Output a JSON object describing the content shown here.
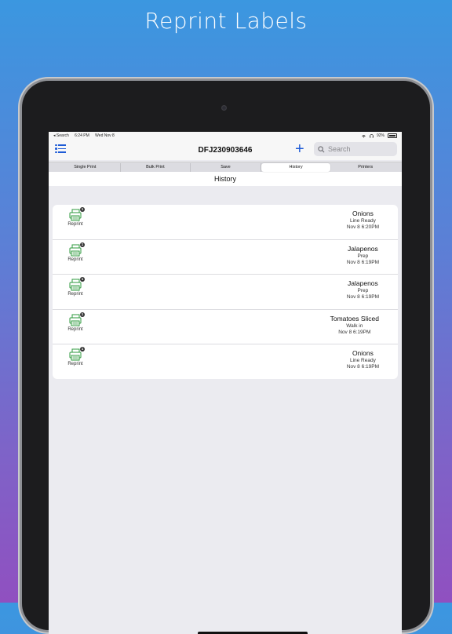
{
  "headline": "Reprint Labels",
  "status_bar": {
    "back_app": "◂ Search",
    "time": "6:24 PM",
    "date": "Wed Nov 8",
    "battery": "92%"
  },
  "nav": {
    "title": "DFJ230903646",
    "plus": "+",
    "search_placeholder": "Search"
  },
  "segments": [
    {
      "label": "Single Print"
    },
    {
      "label": "Bulk Print"
    },
    {
      "label": "Save"
    },
    {
      "label": "History"
    },
    {
      "label": "Printers"
    }
  ],
  "active_segment": "History",
  "section_title": "History",
  "history": [
    {
      "name": "Onions",
      "category": "Line Ready",
      "time": "Nov 8 6:20PM",
      "badge": "1",
      "action": "Reprint"
    },
    {
      "name": "Jalapenos",
      "category": "Prep",
      "time": "Nov 8 6:19PM",
      "badge": "1",
      "action": "Reprint"
    },
    {
      "name": "Jalapenos",
      "category": "Prep",
      "time": "Nov 8 6:19PM",
      "badge": "1",
      "action": "Reprint"
    },
    {
      "name": "Tomatoes Sliced",
      "category": "Walk in",
      "time": "Nov 8 6:19PM",
      "badge": "1",
      "action": "Reprint"
    },
    {
      "name": "Onions",
      "category": "Line Ready",
      "time": "Nov 8 6:19PM",
      "badge": "1",
      "action": "Reprint"
    }
  ],
  "colors": {
    "accent": "#1e5bd6",
    "printer_icon": "#2e9a3c",
    "gradient_top": "#3b97e0",
    "gradient_bottom": "#9050c0"
  },
  "icons": [
    "list-icon",
    "plus-icon",
    "search-icon",
    "printer-icon",
    "wifi-icon",
    "headphones-icon",
    "battery-icon"
  ]
}
